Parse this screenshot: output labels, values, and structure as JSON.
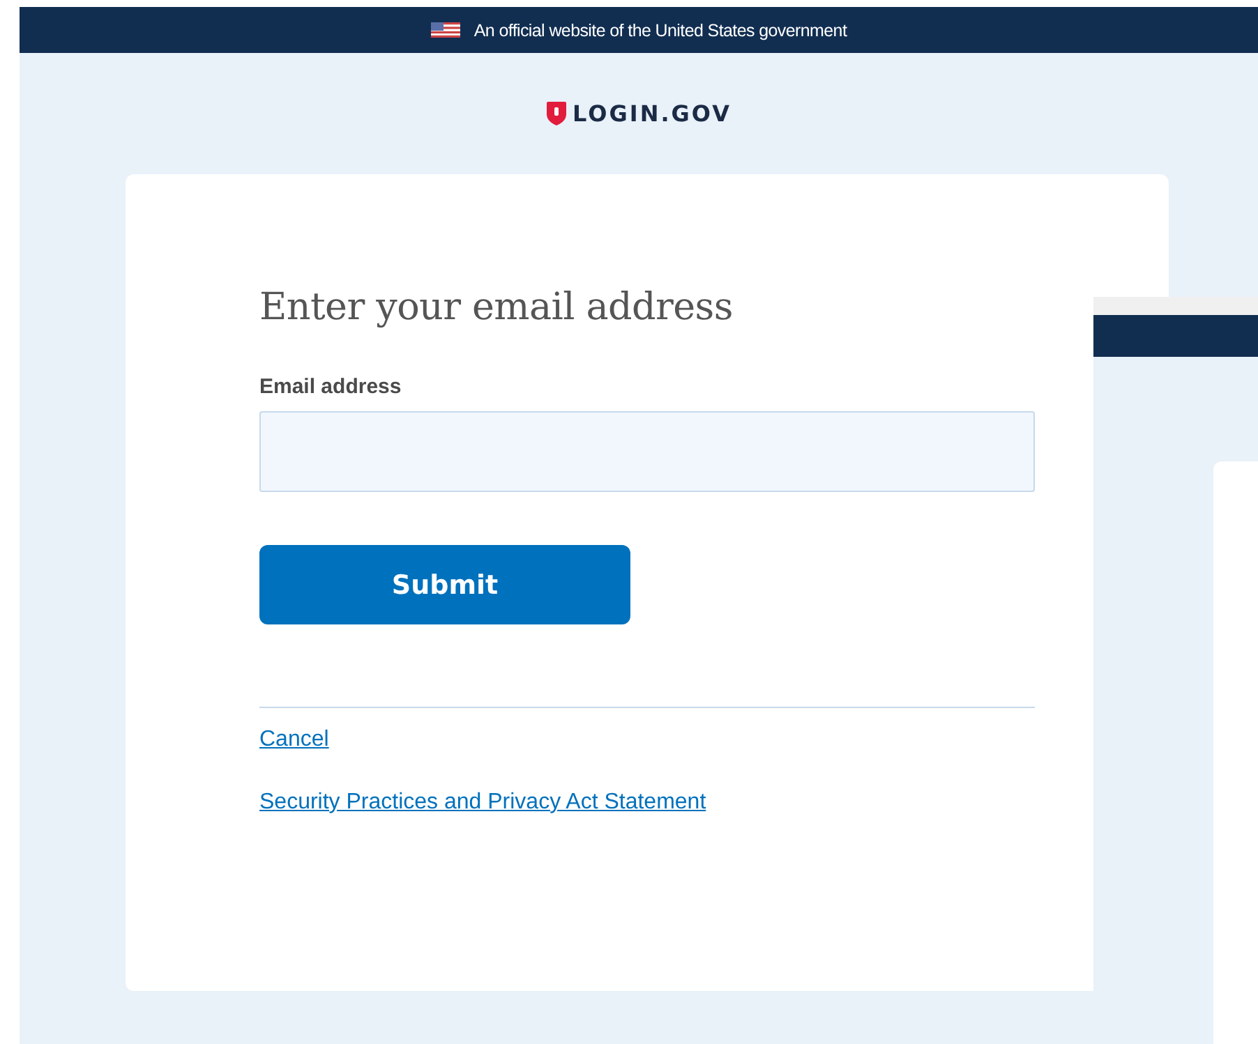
{
  "banner": {
    "text": "An official website of the United States government"
  },
  "logo": {
    "text": "LOGIN.GOV"
  },
  "form": {
    "heading": "Enter your email address",
    "field_label": "Email address",
    "submit": "Submit"
  },
  "links": [
    "Cancel",
    "Security Practices and Privacy Act Statement"
  ]
}
